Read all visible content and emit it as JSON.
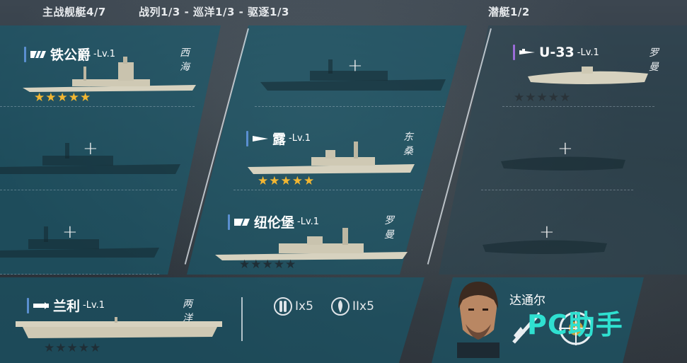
{
  "header": {
    "main": "主战舰艇4/7",
    "classes": "战列1/3 - 巡洋1/3 - 驱逐1/3",
    "sub": "潜艇1/2"
  },
  "ships": [
    {
      "name": "铁公爵",
      "level": "-Lv.1",
      "nation": "西海",
      "stars": "★★★★★",
      "star_color": "#f2b632",
      "bar_color": "#5a8fd0"
    },
    {
      "name": "露",
      "level": "-Lv.1",
      "nation": "东桑",
      "stars": "★★★★★",
      "star_color": "#f2b632",
      "bar_color": "#5a8fd0"
    },
    {
      "name": "纽伦堡",
      "level": "-Lv.1",
      "nation": "罗曼",
      "stars": "★★★★★",
      "star_color": "#1f2e36",
      "bar_color": "#5a8fd0"
    },
    {
      "name": "U-33",
      "level": "-Lv.1",
      "nation": "罗曼",
      "stars": "★★★★★",
      "star_color": "#2a3339",
      "bar_color": "#9a6cd8"
    },
    {
      "name": "兰利",
      "level": "-Lv.1",
      "nation": "两洋",
      "stars": "★★★★★",
      "star_color": "#1f2e36",
      "bar_color": "#5a8fd0"
    }
  ],
  "ammo": {
    "torpedo": "Ix5",
    "depth_charge": "IIx5"
  },
  "commander": {
    "name": "达通尔"
  },
  "watermark": "PC助手",
  "empty_slot": "+"
}
